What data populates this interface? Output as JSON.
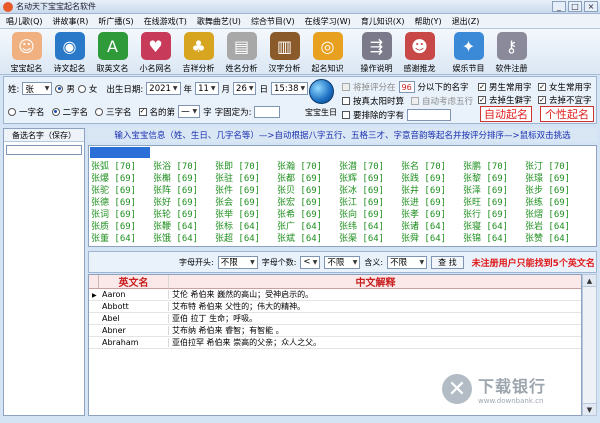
{
  "window": {
    "title": "名动天下宝宝起名软件",
    "controls": [
      "_",
      "□",
      "×"
    ]
  },
  "menu": [
    "唱儿歌(Q)",
    "讲故事(R)",
    "听广播(S)",
    "在线游戏(T)",
    "歌舞曲艺(U)",
    "综合节目(V)",
    "在线学习(W)",
    "育儿知识(X)",
    "帮助(Y)",
    "退出(Z)"
  ],
  "toolbar": [
    {
      "label": "宝宝起名",
      "icon": "baby-face-icon",
      "color": "#f0b080",
      "glyph": "☺"
    },
    {
      "label": "诗文起名",
      "icon": "globe-icon",
      "color": "#2a78c8",
      "glyph": "◉"
    },
    {
      "label": "取英文名",
      "icon": "green-book-icon",
      "color": "#2f9a3a",
      "glyph": "A"
    },
    {
      "label": "小名网名",
      "icon": "heart-card-icon",
      "color": "#c83a5a",
      "glyph": "♥"
    },
    {
      "label": "吉祥分析",
      "icon": "gourd-icon",
      "color": "#d8a520",
      "glyph": "♣"
    },
    {
      "label": "姓名分析",
      "icon": "certificate-icon",
      "color": "#a8a8a8",
      "glyph": "▤"
    },
    {
      "label": "汉字分析",
      "icon": "books-icon",
      "color": "#8a5a2a",
      "glyph": "▥"
    },
    {
      "label": "起名知识",
      "icon": "cd-disc-icon",
      "color": "#e8a020",
      "glyph": "◎"
    },
    {
      "label": "操作说明",
      "icon": "signpost-icon",
      "color": "#7a7a8a",
      "glyph": "⇶"
    },
    {
      "label": "感谢推龙",
      "icon": "people-icon",
      "color": "#c84848",
      "glyph": "☻"
    },
    {
      "label": "娱乐节目",
      "icon": "gift-box-icon",
      "color": "#3a8ad8",
      "glyph": "✦"
    },
    {
      "label": "软件注册",
      "icon": "keys-icon",
      "color": "#8a8a9a",
      "glyph": "⚷"
    }
  ],
  "options": {
    "surname_label": "姓:",
    "surname_value": "张",
    "gender_male": "男",
    "gender_female": "女",
    "birth_label": "出生日期:",
    "year": "2021",
    "year_unit": "年",
    "month": "11",
    "month_unit": "月",
    "day": "26",
    "day_unit": "日",
    "time": "15:38",
    "one_char": "一字名",
    "two_char": "二字名",
    "three_char": "三字名",
    "name_pos_label": "名的第",
    "name_pos_value": "一",
    "name_pos_unit": "字",
    "fixed_char_label": "字固定为:",
    "fixed_char_value": "",
    "baby_birth_btn": "宝宝生日",
    "skip_score_label": "将掉评分在",
    "skip_score_value": "96",
    "skip_score_suffix": "分以下的名字",
    "true_solar_time": "按真太阳时算",
    "auto_five_elements": "自动考虑五行",
    "rare_chars": "要排除的字有",
    "rare_chars_value": "",
    "boy_common": "男生常用字",
    "girl_common": "女生常用字",
    "remove_birth_char": "去掉生僻字",
    "remove_bad_char": "去掉不宜字",
    "auto_name_btn": "自动起名",
    "personal_name_btn": "个性起名"
  },
  "left_panel": {
    "header": "备选名字（保存）"
  },
  "hint": "输入宝宝信息（姓、生日、几字名等）—>自动根据八字五行、五格三才、字意音韵等起名并按评分排序—>鼠标双击挑选",
  "name_grid": [
    [
      "张弧 [70]",
      "张浴 [70]",
      "张即 [70]",
      "张瀚 [70]",
      "张潜 [70]",
      "张名 [70]",
      "张鹏 [70]",
      "张汀 [70]"
    ],
    [
      "张爆 [69]",
      "张槲 [69]",
      "张驻 [69]",
      "张都 [69]",
      "张辉 [69]",
      "张践 [69]",
      "张黎 [69]",
      "张璟 [69]"
    ],
    [
      "张驼 [69]",
      "张阵 [69]",
      "张件 [69]",
      "张贝 [69]",
      "张冰 [69]",
      "张井 [69]",
      "张泽 [69]",
      "张步 [69]"
    ],
    [
      "张德 [69]",
      "张好 [69]",
      "张会 [69]",
      "张宏 [69]",
      "张江 [69]",
      "张进 [69]",
      "张旺 [69]",
      "张练 [69]"
    ],
    [
      "张词 [69]",
      "张轮 [69]",
      "张举 [69]",
      "张希 [69]",
      "张向 [69]",
      "张孝 [69]",
      "张行 [69]",
      "张熠 [69]"
    ],
    [
      "张质 [69]",
      "张鞭 [64]",
      "张标 [64]",
      "张广 [64]",
      "张纬 [64]",
      "张诸 [64]",
      "张寝 [64]",
      "张岩 [64]"
    ],
    [
      "张董 [64]",
      "张饿 [64]",
      "张超 [64]",
      "张斌 [64]",
      "张渠 [64]",
      "张舜 [64]",
      "张锦 [64]",
      "张赞 [64]"
    ]
  ],
  "filter": {
    "first_letter_label": "字母开头:",
    "first_letter_value": "不限",
    "letter_count_label": "字母个数:",
    "letter_count_op": "<",
    "letter_count_value": "不限",
    "meaning_label": "含义:",
    "meaning_value": "不限",
    "search_btn": "查 找",
    "warning": "未注册用户只能找到5个英文名"
  },
  "table": {
    "col_english": "英文名",
    "col_chinese": "中文解释",
    "rows": [
      {
        "en": "Aaron",
        "zh": "艾伦 希伯来 巍然的高山；受神启示的。"
      },
      {
        "en": "Abbott",
        "zh": "艾布特 希伯来 父性的；伟大的精神。"
      },
      {
        "en": "Abel",
        "zh": "亚伯 拉丁 生命；呼吸。"
      },
      {
        "en": "Abner",
        "zh": "艾布纳 希伯来 睿智；有智能 。"
      },
      {
        "en": "Abraham",
        "zh": "亚伯拉罕 希伯来 崇高的父亲；众人之父。"
      }
    ]
  },
  "watermark": {
    "big": "下载银行",
    "small": "www.downbank.cn"
  }
}
